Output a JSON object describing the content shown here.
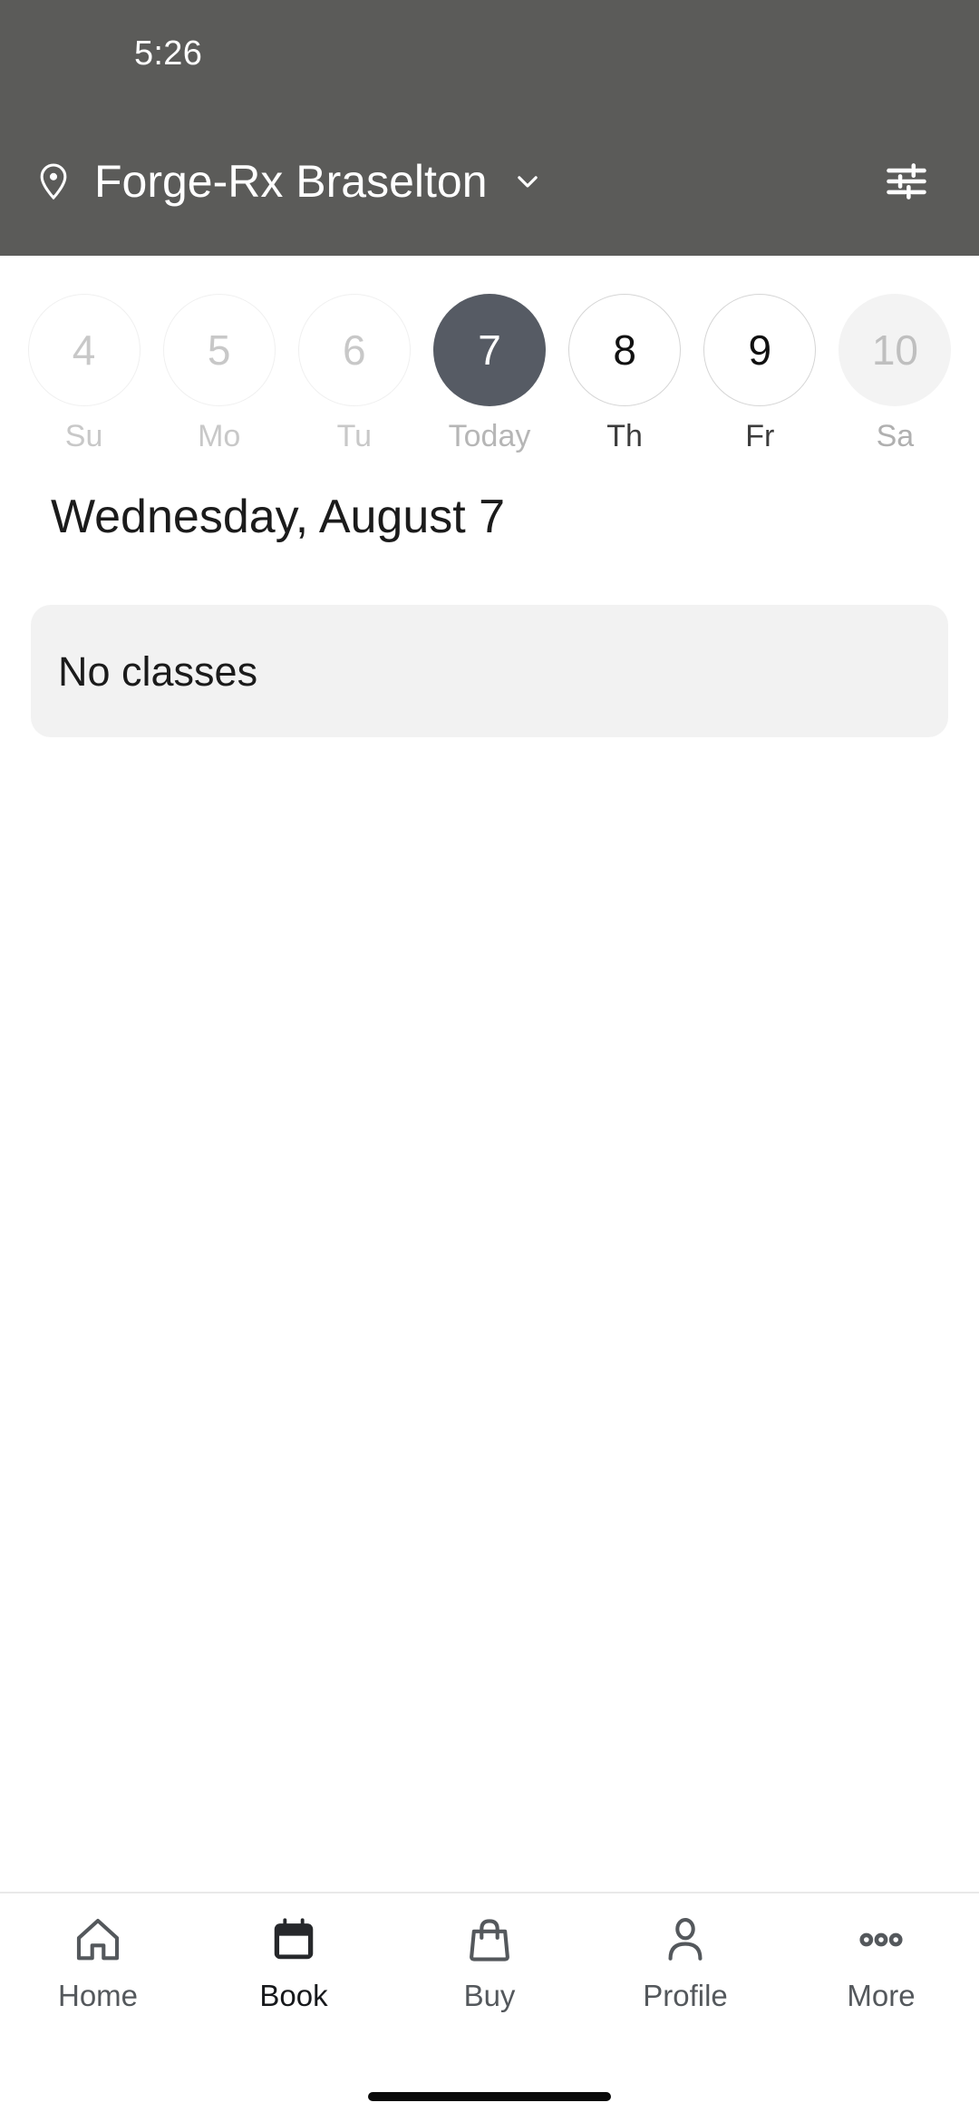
{
  "status_bar": {
    "time": "5:26"
  },
  "header": {
    "location_icon": "location-pin-icon",
    "location_name": "Forge-Rx Braselton",
    "dropdown_icon": "chevron-down-icon",
    "filter_icon": "tune-sliders-icon",
    "background_color": "#5b5b59"
  },
  "date_strip": {
    "days": [
      {
        "number": "4",
        "label": "Su",
        "state": "past"
      },
      {
        "number": "5",
        "label": "Mo",
        "state": "past"
      },
      {
        "number": "6",
        "label": "Tu",
        "state": "past"
      },
      {
        "number": "7",
        "label": "Today",
        "state": "today"
      },
      {
        "number": "8",
        "label": "Th",
        "state": "future"
      },
      {
        "number": "9",
        "label": "Fr",
        "state": "future"
      },
      {
        "number": "10",
        "label": "Sa",
        "state": "dim"
      }
    ],
    "selected_color": "#565b64"
  },
  "main": {
    "date_heading": "Wednesday, August 7",
    "empty_card_text": "No classes",
    "empty_card_color": "#f2f2f2"
  },
  "bottom_nav": {
    "items": [
      {
        "label": "Home",
        "icon": "house-icon",
        "active": false
      },
      {
        "label": "Book",
        "icon": "calendar-icon",
        "active": true
      },
      {
        "label": "Buy",
        "icon": "shopping-bag-icon",
        "active": false
      },
      {
        "label": "Profile",
        "icon": "person-icon",
        "active": false
      },
      {
        "label": "More",
        "icon": "three-dots-icon",
        "active": false
      }
    ],
    "inactive_color": "#54585c",
    "active_color": "#16181b"
  }
}
